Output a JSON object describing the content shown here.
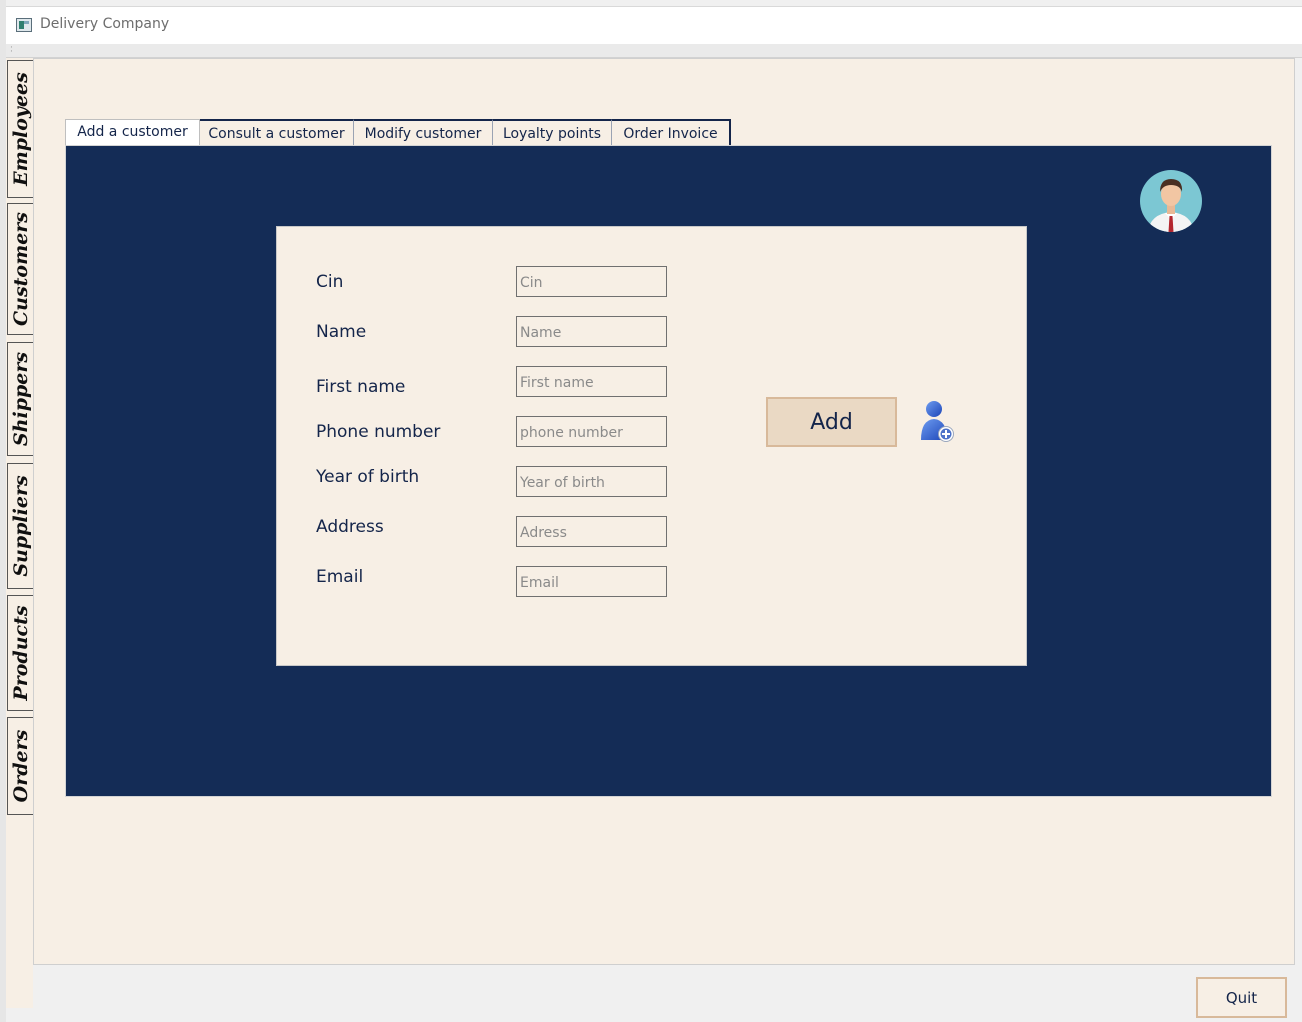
{
  "window": {
    "title": "Delivery Company"
  },
  "side_tabs": [
    "Employees",
    "Customers",
    "Shippers",
    "Suppliers",
    "Products",
    "Orders"
  ],
  "tabs": [
    {
      "label": "Add a customer",
      "active": true
    },
    {
      "label": "Consult a customer",
      "active": false
    },
    {
      "label": "Modify customer",
      "active": false
    },
    {
      "label": "Loyalty points",
      "active": false
    },
    {
      "label": "Order Invoice",
      "active": false
    }
  ],
  "form": {
    "fields": [
      {
        "label": "Cin",
        "placeholder": "Cin",
        "value": ""
      },
      {
        "label": "Name",
        "placeholder": "Name",
        "value": ""
      },
      {
        "label": "First name",
        "placeholder": "First name",
        "value": ""
      },
      {
        "label": "Phone number",
        "placeholder": "phone number",
        "value": ""
      },
      {
        "label": "Year of birth",
        "placeholder": "Year of birth",
        "value": ""
      },
      {
        "label": "Address",
        "placeholder": "Adress",
        "value": ""
      },
      {
        "label": "Email",
        "placeholder": "Email",
        "value": ""
      }
    ],
    "add_label": "Add"
  },
  "footer": {
    "quit_label": "Quit"
  },
  "icons": {
    "app": "app-window-icon",
    "avatar": "businessman-avatar-icon",
    "add_user": "add-user-icon"
  },
  "colors": {
    "panel_background": "#f7efe5",
    "navy": "#142c56",
    "button_fill": "#ead9c4",
    "button_border": "#d8b99a",
    "text": "#14254a"
  }
}
